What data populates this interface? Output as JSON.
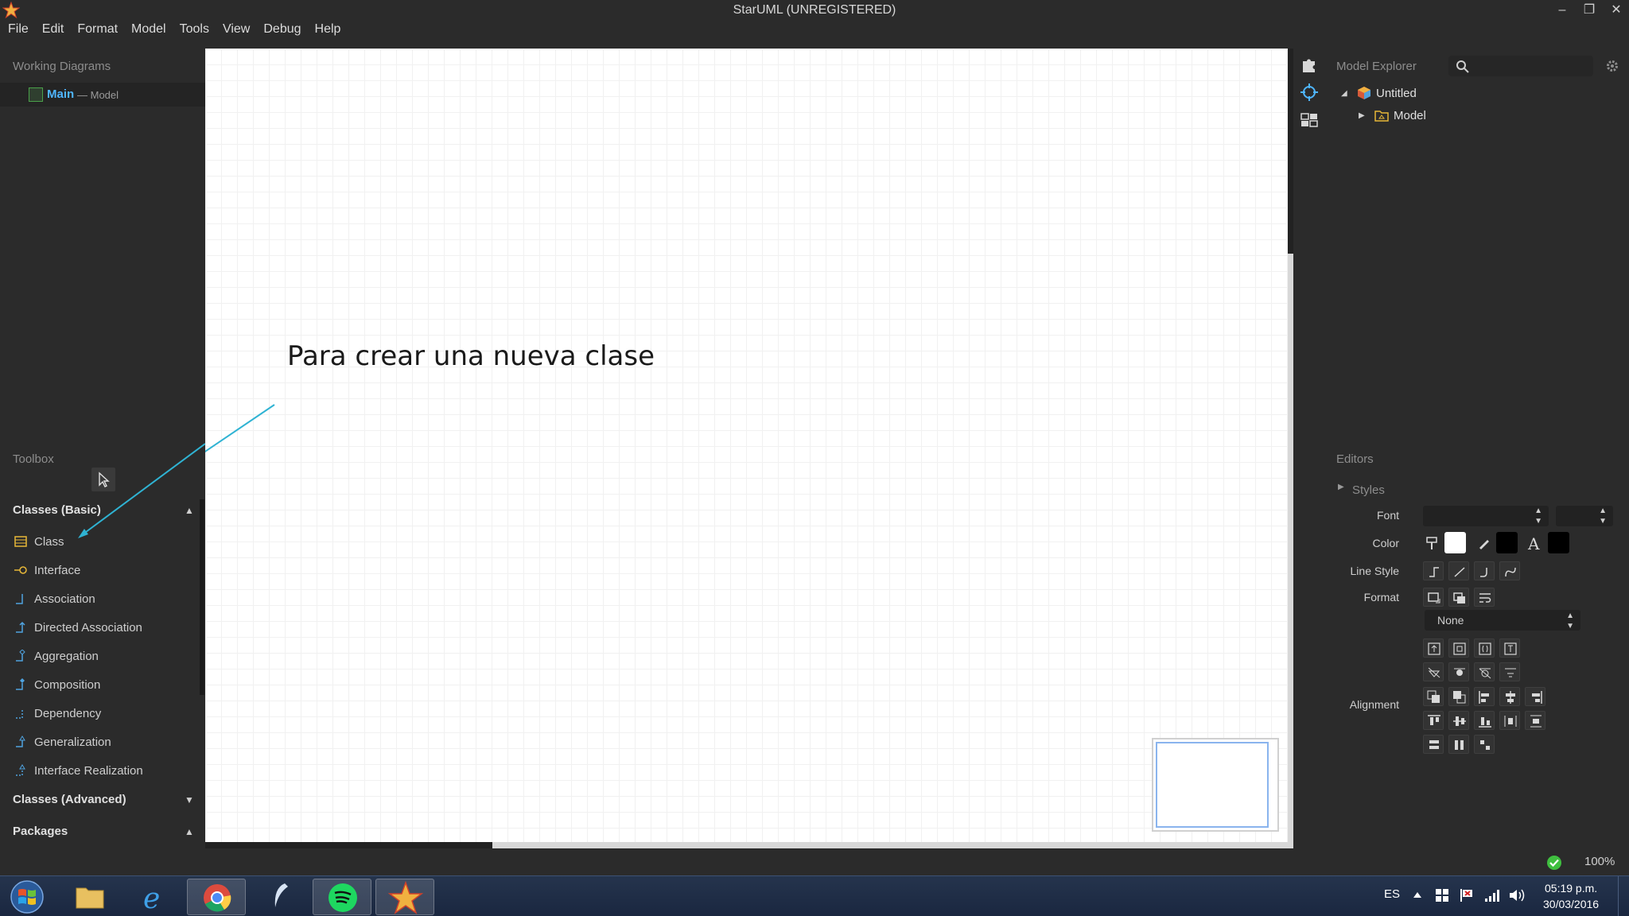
{
  "window": {
    "title": "StarUML (UNREGISTERED)",
    "minimize": "–",
    "restore": "❐",
    "close": "✕"
  },
  "menu": [
    "File",
    "Edit",
    "Format",
    "Model",
    "Tools",
    "View",
    "Debug",
    "Help"
  ],
  "working_diagrams": {
    "title": "Working Diagrams",
    "items": [
      {
        "name": "Main",
        "owner": "— Model"
      }
    ]
  },
  "toolbox": {
    "title": "Toolbox",
    "sections": [
      {
        "label": "Classes (Basic)",
        "arrow": "▲"
      },
      {
        "label": "Classes (Advanced)",
        "arrow": "▼"
      },
      {
        "label": "Packages",
        "arrow": "▲"
      }
    ],
    "items": [
      "Class",
      "Interface",
      "Association",
      "Directed Association",
      "Aggregation",
      "Composition",
      "Dependency",
      "Generalization",
      "Interface Realization"
    ]
  },
  "canvas": {
    "annotation": "Para crear una nueva clase"
  },
  "model_explorer": {
    "title": "Model Explorer",
    "tree": [
      {
        "label": "Untitled",
        "toggle": "◢"
      },
      {
        "label": "Model",
        "toggle": "▶"
      }
    ]
  },
  "editors": {
    "title": "Editors",
    "styles_label": "Styles",
    "styles_toggle": "▶",
    "font_label": "Font",
    "color_label": "Color",
    "line_style_label": "Line Style",
    "format_label": "Format",
    "format_value": "None",
    "alignment_label": "Alignment",
    "font_glyph": "A",
    "fill_color": "#ffffff",
    "line_color": "#000000",
    "font_color": "#000000"
  },
  "status": {
    "zoom": "100%"
  },
  "taskbar": {
    "language": "ES",
    "time": "05:19 p.m.",
    "date": "30/03/2016"
  },
  "colors": {
    "accent": "#4fb6ff",
    "annotation_arrow": "#2fb3d3",
    "status_ok": "#3fbf3f"
  }
}
